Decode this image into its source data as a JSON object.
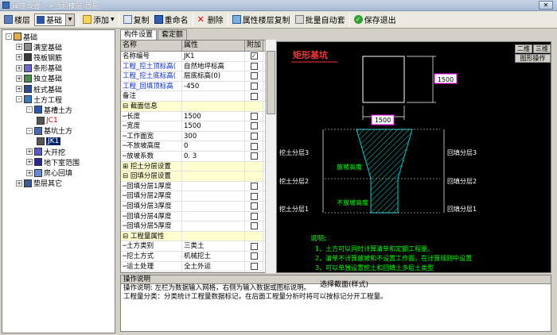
{
  "window": {
    "title": "属性设置: ->当前楼层:首层"
  },
  "toolbar": {
    "floor_label": "楼层",
    "combo_value": "基础",
    "add_label": "添加",
    "copy_label": "复制",
    "rename_label": "重命名",
    "delete_label": "删除",
    "copy_attr_label": "属性楼层复制",
    "batch_label": "批量自动套",
    "save_label": "保存退出"
  },
  "tree": [
    {
      "label": "基础",
      "depth": 0,
      "exp": "-",
      "icon": "folder"
    },
    {
      "label": "满堂基础",
      "depth": 1,
      "exp": "+",
      "icon": "slab"
    },
    {
      "label": "筏板钢筋",
      "depth": 1,
      "exp": "+",
      "icon": "rebar"
    },
    {
      "label": "条形基础",
      "depth": 1,
      "exp": "+",
      "icon": "strip"
    },
    {
      "label": "独立基础",
      "depth": 1,
      "exp": "+",
      "icon": "pad"
    },
    {
      "label": "桩式基础",
      "depth": 1,
      "exp": "+",
      "icon": "pile"
    },
    {
      "label": "土方工程",
      "depth": 1,
      "exp": "-",
      "icon": "earth"
    },
    {
      "label": "基槽土方",
      "depth": 2,
      "exp": "-",
      "icon": "trench"
    },
    {
      "label": "JC1",
      "depth": 3,
      "exp": "",
      "icon": "item",
      "red": true
    },
    {
      "label": "基坑土方",
      "depth": 2,
      "exp": "-",
      "icon": "pit"
    },
    {
      "label": "JK1",
      "depth": 3,
      "exp": "",
      "icon": "item",
      "sel": true
    },
    {
      "label": "大开挖",
      "depth": 2,
      "exp": "+",
      "icon": "dig"
    },
    {
      "label": "地下室范围",
      "depth": 2,
      "exp": "+",
      "icon": "base"
    },
    {
      "label": "房心回填",
      "depth": 2,
      "exp": "+",
      "icon": "fill"
    },
    {
      "label": "垫层其它",
      "depth": 1,
      "exp": "+",
      "icon": "cush"
    }
  ],
  "tabs": [
    "构件设置",
    "套定额"
  ],
  "grid": {
    "headers": [
      "名称",
      "属性",
      "附加"
    ],
    "rows": [
      {
        "n": "名称编号",
        "v": "JK1",
        "chk": "✓",
        "blue": false,
        "yel": false
      },
      {
        "n": "工程_挖土顶标高(",
        "v": "自然地坪标高",
        "chk": "",
        "blue": true,
        "yel": false
      },
      {
        "n": "工程_挖土底标高(",
        "v": "层底标高(0)",
        "chk": "",
        "blue": true,
        "yel": false
      },
      {
        "n": "工程_回填顶标高",
        "v": "-450",
        "chk": "",
        "blue": true,
        "yel": false
      },
      {
        "n": "备注",
        "v": "",
        "chk": "",
        "blue": false,
        "yel": false
      },
      {
        "n": "⊟ 截面信息",
        "v": "",
        "chk": "",
        "blue": false,
        "yel": true
      },
      {
        "n": "  ─长度",
        "v": "1500",
        "chk": "",
        "blue": false,
        "yel": false
      },
      {
        "n": "  ─宽度",
        "v": "1500",
        "chk": "",
        "blue": false,
        "yel": false
      },
      {
        "n": "  ─工作面宽",
        "v": "300",
        "chk": "",
        "blue": false,
        "yel": false
      },
      {
        "n": "  ─不放坡高度",
        "v": "0",
        "chk": "",
        "blue": false,
        "yel": false
      },
      {
        "n": "  ─放坡系数",
        "v": "0. 3",
        "chk": "",
        "blue": false,
        "yel": false
      },
      {
        "n": "⊞ 挖土分层设置",
        "v": "",
        "chk": "",
        "blue": false,
        "yel": true
      },
      {
        "n": "⊟ 回填分层设置",
        "v": "",
        "chk": "",
        "blue": false,
        "yel": true
      },
      {
        "n": "  ─回填分层1厚度",
        "v": "",
        "chk": "",
        "blue": false,
        "yel": false
      },
      {
        "n": "  ─回填分层2厚度",
        "v": "",
        "chk": "",
        "blue": false,
        "yel": false
      },
      {
        "n": "  ─回填分层3厚度",
        "v": "",
        "chk": "",
        "blue": false,
        "yel": false
      },
      {
        "n": "  ─回填分层4厚度",
        "v": "",
        "chk": "",
        "blue": false,
        "yel": false
      },
      {
        "n": "  ─回填分层5厚度",
        "v": "",
        "chk": "",
        "blue": false,
        "yel": false
      },
      {
        "n": "⊟ 工程量属性",
        "v": "",
        "chk": "",
        "blue": false,
        "yel": true
      },
      {
        "n": "  ─土方类别",
        "v": "三类土",
        "chk": "",
        "blue": false,
        "yel": false
      },
      {
        "n": "  ─挖土方式",
        "v": "机械挖土",
        "chk": "",
        "blue": false,
        "yel": false
      },
      {
        "n": "  ─运土处理",
        "v": "全土外运",
        "chk": "",
        "blue": false,
        "yel": false
      },
      {
        "n": "  ─回土处理",
        "v": "余土回填",
        "chk": "",
        "blue": false,
        "yel": false
      }
    ]
  },
  "canvas": {
    "title": "矩形基坑",
    "btn_2d": "二维",
    "btn_3d": "三维",
    "btn_op": "图形操作",
    "dim1": "1500",
    "dim2": "1500",
    "lbl_slope": "放坡高度",
    "lbl_noslope": "不放坡高度",
    "left_layers": [
      "挖土分层3",
      "挖土分层2",
      "挖土分层1"
    ],
    "right_layers": [
      "回填分层3",
      "回填分层2",
      "回填分层1"
    ],
    "notes_title": "说明:",
    "notes": [
      "1、土方可以同时计算清单和定额工程量。",
      "2、清单不计算放坡和不设置工作面，在计算规则中设置",
      "3、可以单独设置挖土和回填土多层土类型"
    ]
  },
  "bottom": {
    "select_label": "选择截面(样式)",
    "header": "操作说明",
    "lines": [
      "操作说明:  左栏为数据输入网格，右侧为输入数据或图标说明。",
      "工程量分类：分类统计工程量数据标记，在后面工程量分析时将可以按标记分开工程量。"
    ]
  },
  "colors": {
    "dim_box": "#ff00ff",
    "hatch": "#00cccc",
    "text_green": "#00ff00",
    "title_red": "#ff3333",
    "white": "#ffffff"
  }
}
